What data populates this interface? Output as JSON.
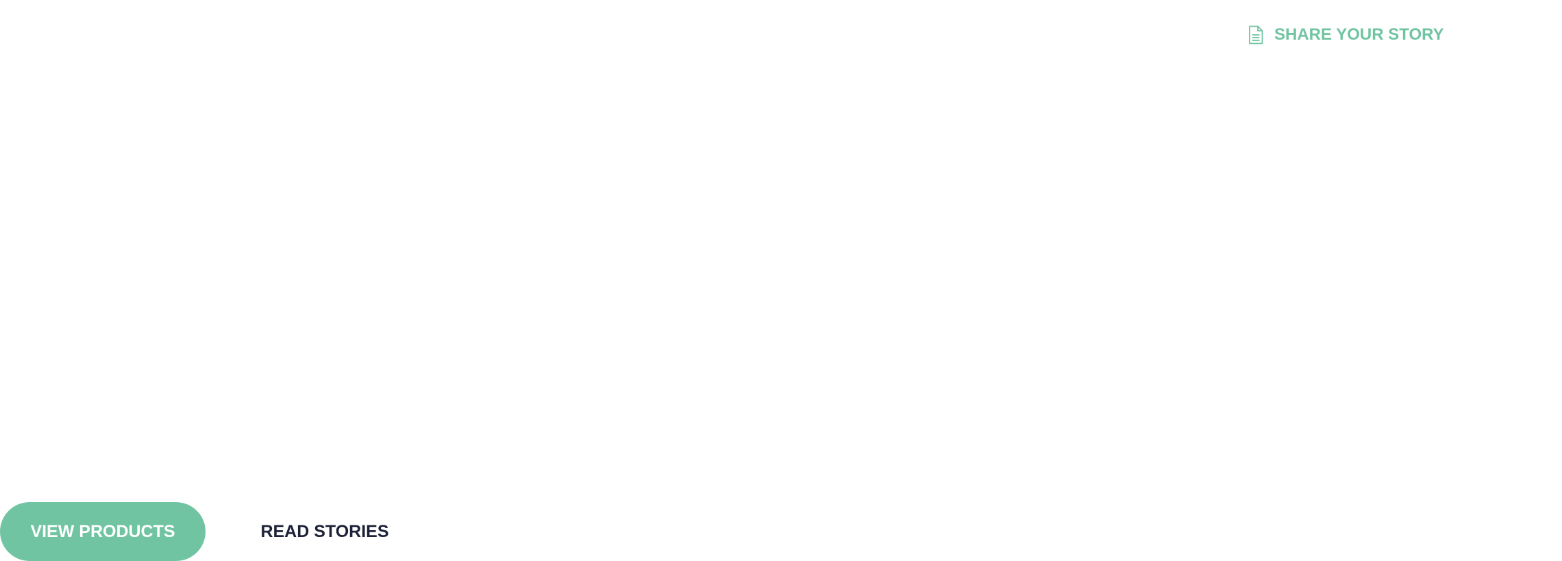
{
  "header": {
    "share_link": {
      "label": "SHARE YOUR STORY",
      "icon": "document-icon"
    }
  },
  "actions": {
    "view_products_label": "VIEW PRODUCTS",
    "read_stories_label": "READ STORIES"
  },
  "colors": {
    "accent": "#70c4a2",
    "dark_text": "#1d2238",
    "background": "#ffffff"
  }
}
